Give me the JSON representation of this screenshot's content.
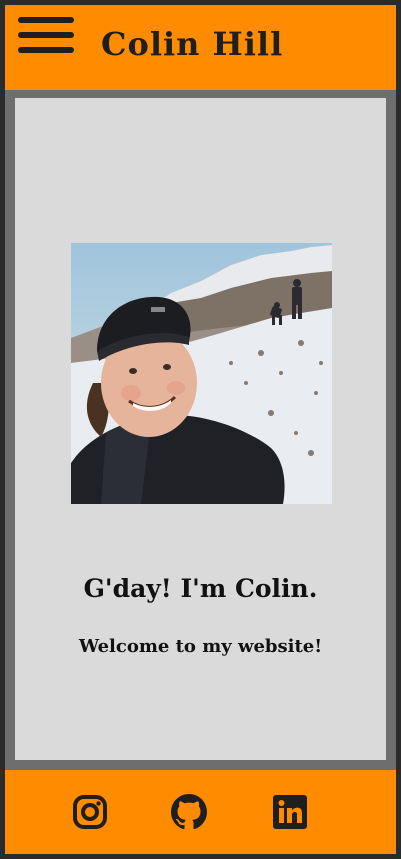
{
  "header": {
    "title": "Colin Hill",
    "menu_icon": "hamburger-menu-icon",
    "background": "#ff8c00"
  },
  "main": {
    "photo_alt": "Colin selfie in snowy mountains",
    "greeting": "G'day! I'm Colin.",
    "welcome": "Welcome to my website!"
  },
  "footer": {
    "links": [
      {
        "icon": "instagram-icon"
      },
      {
        "icon": "github-icon"
      },
      {
        "icon": "linkedin-icon"
      }
    ]
  },
  "colors": {
    "accent": "#ff8c00",
    "frame": "#2b2b2b",
    "content_bg": "#dadada",
    "content_border": "#6e6e6e",
    "text": "#111111"
  }
}
